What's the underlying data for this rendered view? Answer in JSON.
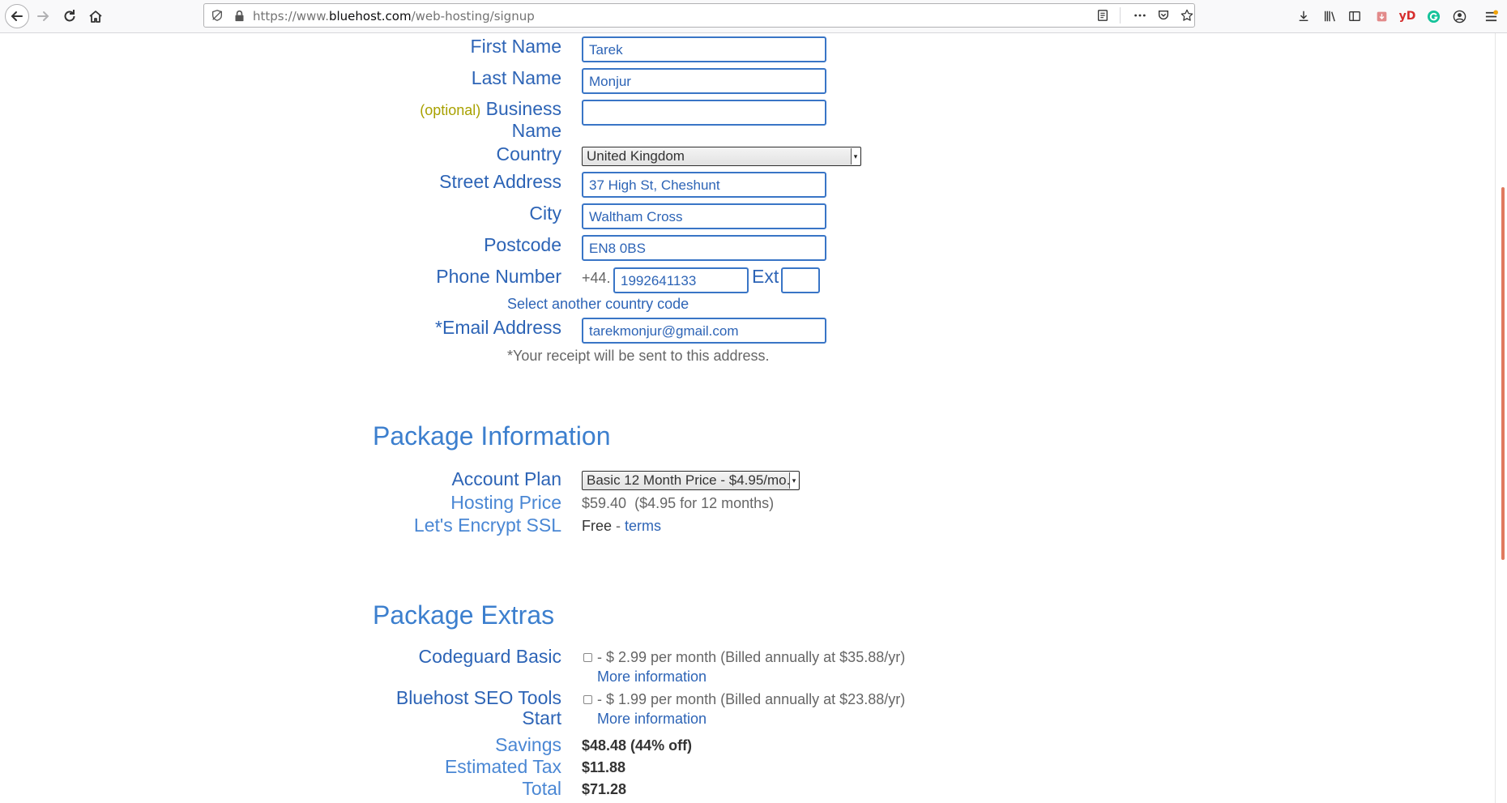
{
  "browser": {
    "url_scheme": "https://www.",
    "url_domain": "bluehost.com",
    "url_path": "/web-hosting/signup",
    "toolbar_icons": [
      "back-icon",
      "forward-icon",
      "reload-icon",
      "home-icon",
      "tracking-protection-icon",
      "lock-icon",
      "reader-view-icon",
      "more-actions-icon",
      "pocket-icon",
      "bookmark-star-icon",
      "download-icon",
      "library-icon",
      "sidebar-icon",
      "extension-icon",
      "yd-extension-icon",
      "grammarly-icon",
      "account-icon",
      "menu-icon"
    ],
    "ext_yd_label": "yD"
  },
  "form": {
    "first_name": {
      "label": "First Name",
      "value": "Tarek"
    },
    "last_name": {
      "label": "Last Name",
      "value": "Monjur"
    },
    "business_name": {
      "optional": "(optional)",
      "label_line1": "Business",
      "label_line2": "Name",
      "value": ""
    },
    "country": {
      "label": "Country",
      "value": "United Kingdom"
    },
    "street_address": {
      "label": "Street Address",
      "value": "37 High St, Cheshunt"
    },
    "city": {
      "label": "City",
      "value": "Waltham Cross"
    },
    "postcode": {
      "label": "Postcode",
      "value": "EN8 0BS"
    },
    "phone": {
      "label": "Phone Number",
      "prefix": "+44.",
      "value": "1992641133",
      "ext_label": "Ext",
      "ext_value": ""
    },
    "country_code_link": "Select another country code",
    "email": {
      "label": "*Email Address",
      "value": "tarekmonjur@gmail.com"
    },
    "receipt_note": "*Your receipt will be sent to this address."
  },
  "package_info": {
    "heading": "Package Information",
    "account_plan": {
      "label": "Account Plan",
      "value": "Basic 12 Month Price - $4.95/mo."
    },
    "hosting_price": {
      "label": "Hosting Price",
      "value": "$59.40",
      "detail": "($4.95 for 12 months)"
    },
    "ssl": {
      "label": "Let's Encrypt SSL",
      "value": "Free",
      "sep": "-",
      "link": "terms"
    }
  },
  "package_extras": {
    "heading": "Package Extras",
    "items": [
      {
        "label": "Codeguard Basic",
        "checked": false,
        "text": "- $ 2.99 per month (Billed annually at $35.88/yr)",
        "link": "More information"
      },
      {
        "label_line1": "Bluehost SEO Tools",
        "label_line2": "Start",
        "checked": false,
        "text": "- $ 1.99 per month (Billed annually at $23.88/yr)",
        "link": "More information"
      }
    ],
    "savings": {
      "label": "Savings",
      "value": "$48.48 (44% off)"
    },
    "tax": {
      "label": "Estimated Tax",
      "value": "$11.88"
    },
    "total": {
      "label": "Total",
      "value": "$71.28"
    }
  },
  "colors": {
    "label_blue": "#2d64b6",
    "section_blue": "#3c7fce",
    "optional_olive": "#a8a100",
    "grammarly_green": "#15c39a"
  }
}
